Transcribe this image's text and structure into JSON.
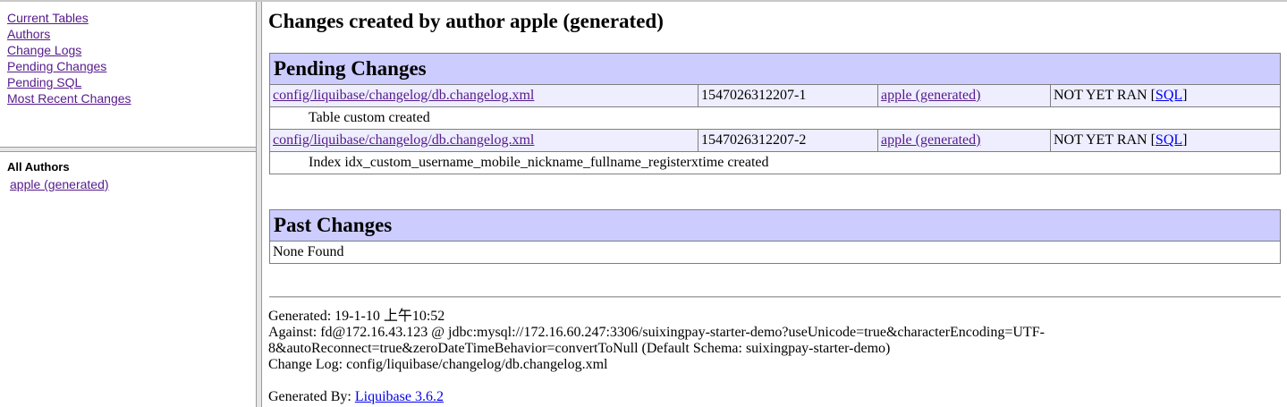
{
  "nav": {
    "links": [
      "Current Tables",
      "Authors",
      "Change Logs",
      "Pending Changes",
      "Pending SQL",
      "Most Recent Changes"
    ]
  },
  "authors": {
    "title": "All Authors",
    "items": [
      "apple (generated)"
    ]
  },
  "main": {
    "title": "Changes created by author apple (generated)",
    "pending": {
      "heading": "Pending Changes",
      "rows": [
        {
          "file": "config/liquibase/changelog/db.changelog.xml",
          "id": "1547026312207-1",
          "author": "apple (generated)",
          "status": "NOT YET RAN [",
          "sql": "SQL",
          "status_end": "]",
          "description": "Table custom created"
        },
        {
          "file": "config/liquibase/changelog/db.changelog.xml",
          "id": "1547026312207-2",
          "author": "apple (generated)",
          "status": "NOT YET RAN [",
          "sql": "SQL",
          "status_end": "]",
          "description": "Index idx_custom_username_mobile_nickname_fullname_registerxtime created"
        }
      ]
    },
    "past": {
      "heading": "Past Changes",
      "none": "None Found"
    }
  },
  "footer": {
    "generated": "Generated: 19-1-10 上午10:52",
    "against_line1": "Against: fd@172.16.43.123 @ jdbc:mysql://172.16.60.247:3306/suixingpay-starter-demo?useUnicode=true&characterEncoding=UTF-",
    "against_line2": "8&autoReconnect=true&zeroDateTimeBehavior=convertToNull (Default Schema: suixingpay-starter-demo)",
    "changelog": "Change Log: config/liquibase/changelog/db.changelog.xml",
    "generated_by_label": "Generated By: ",
    "generated_by_link": "Liquibase 3.6.2"
  }
}
